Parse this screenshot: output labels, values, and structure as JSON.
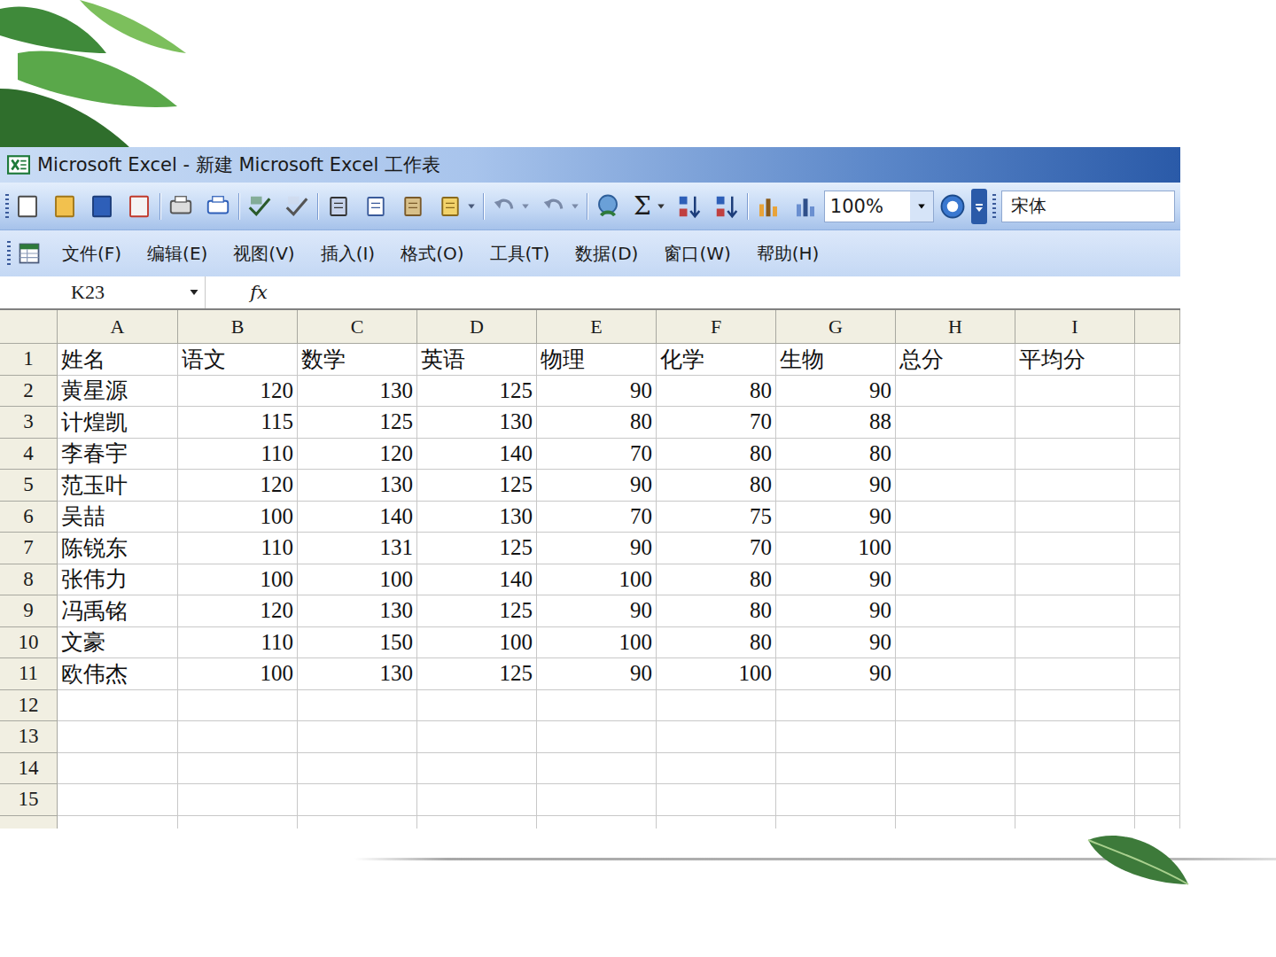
{
  "window": {
    "title": "Microsoft Excel - 新建 Microsoft Excel 工作表"
  },
  "toolbar": {
    "sum": "Σ",
    "zoom": "100%",
    "font": "宋体"
  },
  "menu": [
    "文件(F)",
    "编辑(E)",
    "视图(V)",
    "插入(I)",
    "格式(O)",
    "工具(T)",
    "数据(D)",
    "窗口(W)",
    "帮助(H)"
  ],
  "formula_bar": {
    "name_box": "K23",
    "fx": "fx",
    "content": ""
  },
  "sheet": {
    "columns": [
      "A",
      "B",
      "C",
      "D",
      "E",
      "F",
      "G",
      "H",
      "I"
    ],
    "rows": [
      {
        "number": "1",
        "cells": [
          "姓名",
          "语文",
          "数学",
          "英语",
          "物理",
          "化学",
          "生物",
          "总分",
          "平均分"
        ]
      },
      {
        "number": "2",
        "cells": [
          "黄星源",
          "120",
          "130",
          "125",
          "90",
          "80",
          "90",
          "",
          ""
        ]
      },
      {
        "number": "3",
        "cells": [
          "计煌凯",
          "115",
          "125",
          "130",
          "80",
          "70",
          "88",
          "",
          ""
        ]
      },
      {
        "number": "4",
        "cells": [
          "李春宇",
          "110",
          "120",
          "140",
          "70",
          "80",
          "80",
          "",
          ""
        ]
      },
      {
        "number": "5",
        "cells": [
          "范玉叶",
          "120",
          "130",
          "125",
          "90",
          "80",
          "90",
          "",
          ""
        ]
      },
      {
        "number": "6",
        "cells": [
          "吴喆",
          "100",
          "140",
          "130",
          "70",
          "75",
          "90",
          "",
          ""
        ]
      },
      {
        "number": "7",
        "cells": [
          "陈锐东",
          "110",
          "131",
          "125",
          "90",
          "70",
          "100",
          "",
          ""
        ]
      },
      {
        "number": "8",
        "cells": [
          "张伟力",
          "100",
          "100",
          "140",
          "100",
          "80",
          "90",
          "",
          ""
        ]
      },
      {
        "number": "9",
        "cells": [
          "冯禹铭",
          "120",
          "130",
          "125",
          "90",
          "80",
          "90",
          "",
          ""
        ]
      },
      {
        "number": "10",
        "cells": [
          "文豪",
          "110",
          "150",
          "100",
          "100",
          "80",
          "90",
          "",
          ""
        ]
      },
      {
        "number": "11",
        "cells": [
          "欧伟杰",
          "100",
          "130",
          "125",
          "90",
          "100",
          "90",
          "",
          ""
        ]
      },
      {
        "number": "12",
        "cells": [
          "",
          "",
          "",
          "",
          "",
          "",
          "",
          "",
          ""
        ]
      },
      {
        "number": "13",
        "cells": [
          "",
          "",
          "",
          "",
          "",
          "",
          "",
          "",
          ""
        ]
      },
      {
        "number": "14",
        "cells": [
          "",
          "",
          "",
          "",
          "",
          "",
          "",
          "",
          ""
        ]
      },
      {
        "number": "15",
        "cells": [
          "",
          "",
          "",
          "",
          "",
          "",
          "",
          "",
          ""
        ]
      }
    ]
  }
}
